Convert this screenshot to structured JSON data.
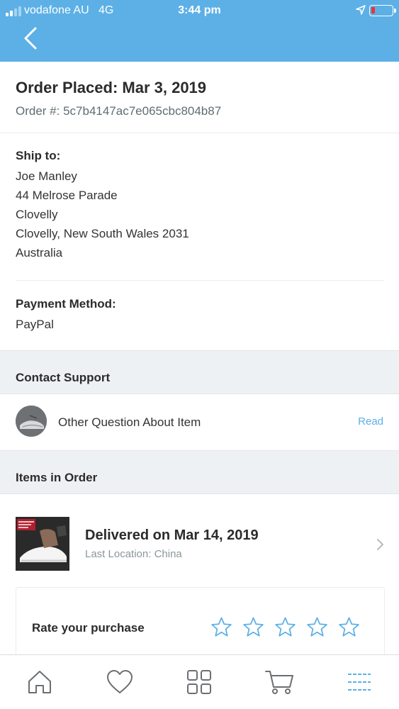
{
  "status_bar": {
    "carrier": "vodafone AU   4G",
    "time": "3:44 pm"
  },
  "order": {
    "title": "Order Placed: Mar 3, 2019",
    "number": "Order #: 5c7b4147ac7e065cbc804b87"
  },
  "shipping": {
    "label": "Ship to:",
    "lines": [
      "Joe Manley",
      "44 Melrose Parade",
      "Clovelly",
      "Clovelly, New South Wales 2031",
      "Australia"
    ]
  },
  "payment": {
    "label": "Payment Method:",
    "value": "PayPal"
  },
  "contact_support": {
    "heading": "Contact Support",
    "item_text": "Other Question About Item",
    "action": "Read"
  },
  "items": {
    "heading": "Items in Order",
    "status": "Delivered on Mar 14, 2019",
    "location": "Last Location: China"
  },
  "rating": {
    "label": "Rate your purchase",
    "star_count": 5,
    "rating": 0
  },
  "tabs": [
    {
      "icon": "home-icon"
    },
    {
      "icon": "heart-icon"
    },
    {
      "icon": "grid-icon"
    },
    {
      "icon": "cart-icon"
    },
    {
      "icon": "menu-icon"
    }
  ],
  "colors": {
    "header": "#5cb0e6",
    "accent": "#5cb0e6",
    "section_band": "#eef1f4",
    "battery_low": "#e33333"
  }
}
